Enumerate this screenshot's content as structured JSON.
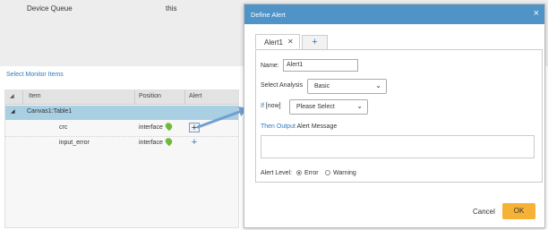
{
  "background": {
    "device_queue_label": "Device Queue",
    "device_queue_value": "this",
    "monitor_title": "Select Monitor Items",
    "table": {
      "columns": [
        "Item",
        "Position",
        "Alert"
      ],
      "group": {
        "toggle": "◢",
        "label": "Canvas1:Table1"
      },
      "rows": [
        {
          "item": "crc",
          "position": "interface"
        },
        {
          "item": "input_error",
          "position": "interface"
        }
      ],
      "add_glyph": "+"
    }
  },
  "dialog": {
    "title": "Define Alert",
    "close_glyph": "×",
    "tabs": {
      "active_label": "Alert1",
      "active_close": "✕",
      "add_glyph": "+"
    },
    "name_label": "Name:",
    "name_value": "Alert1",
    "analysis_label": "Select Analysis",
    "analysis_value": "Basic",
    "if_label": "If",
    "if_suffix": "[now]",
    "condition_placeholder": "Please Select",
    "then_output_label": "Then Output",
    "alert_message_label": "Alert Message",
    "alert_level_label": "Alert Level:",
    "levels": [
      "Error",
      "Warning"
    ],
    "selected_level": "Error",
    "cancel_label": "Cancel",
    "ok_label": "OK"
  },
  "colors": {
    "accent": "#4f93c7",
    "link": "#2e7bbf",
    "ok_button": "#f5b236",
    "group_row": "#a9cfe3",
    "pin": "#6fba3a"
  },
  "icons": [
    "sort-icon",
    "expand-icon",
    "map-pin-icon",
    "add-icon",
    "close-icon",
    "chevron-down-icon",
    "arrow-icon"
  ]
}
